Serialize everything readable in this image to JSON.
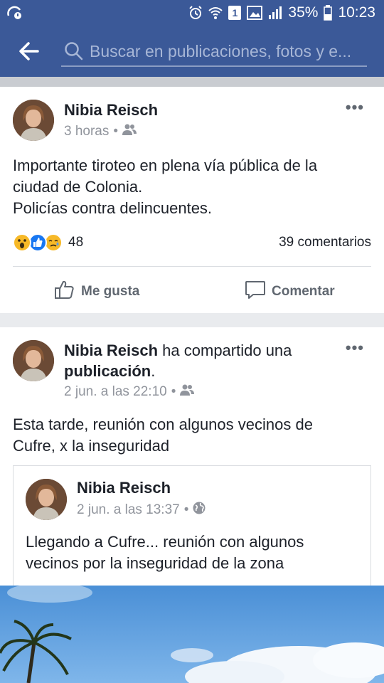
{
  "status_bar": {
    "sim_badge": "1",
    "battery": "35%",
    "time": "10:23",
    "icons": [
      "notification-icon",
      "alarm-icon",
      "wifi-icon",
      "sim-badge-icon",
      "image-icon",
      "signal-icon",
      "battery-icon"
    ]
  },
  "header": {
    "search_placeholder": "Buscar en publicaciones, fotos y e..."
  },
  "posts": [
    {
      "author": "Nibia Reisch",
      "time": "3 horas",
      "privacy_icon": "friends-icon",
      "text_line1": "Importante tiroteo en plena vía pública de la",
      "text_line2": "ciudad de Colonia.",
      "text_line3": "Policías contra delincuentes.",
      "reaction_count": "48",
      "comments": "39 comentarios",
      "like_label": "Me gusta",
      "comment_label": "Comentar"
    },
    {
      "author": "Nibia Reisch",
      "action_text": "ha compartido una",
      "action_object": "publicación",
      "action_period": ".",
      "time": "2 jun. a las 22:10",
      "privacy_icon": "friends-icon",
      "text_line1": "Esta tarde, reunión con algunos vecinos de",
      "text_line2": "Cufre, x la inseguridad",
      "shared": {
        "author": "Nibia Reisch",
        "time": "2 jun. a las 13:37",
        "privacy_icon": "globe-icon",
        "text_line1": "Llegando a Cufre... reunión con algunos",
        "text_line2": "vecinos por la inseguridad de la zona"
      }
    }
  ],
  "colors": {
    "brand_blue": "#3b5998",
    "feed_bg": "#e9ebee",
    "meta_gray": "#90949c"
  }
}
